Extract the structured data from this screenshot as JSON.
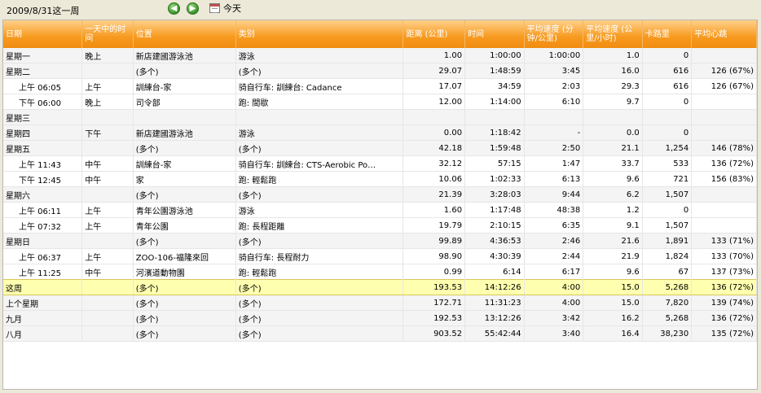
{
  "header": {
    "date_title": "2009/8/31这一周",
    "prev_symbol": "◀",
    "next_symbol": "▶",
    "today_label": "今天"
  },
  "table": {
    "columns": [
      "日期",
      "一天中的时间",
      "位置",
      "类别",
      "距离 (公里)",
      "时间",
      "平均速度 (分钟/公里)",
      "平均速度 (公里/小时)",
      "卡路里",
      "平均心跳"
    ],
    "rows": [
      {
        "kind": "group",
        "cells": [
          "星期一",
          "晚上",
          "新店建國游泳池",
          "游泳",
          "1.00",
          "1:00:00",
          "1:00:00",
          "1.0",
          "0",
          ""
        ]
      },
      {
        "kind": "group",
        "cells": [
          "星期二",
          "",
          "(多个)",
          "(多个)",
          "29.07",
          "1:48:59",
          "3:45",
          "16.0",
          "616",
          "126 (67%)"
        ]
      },
      {
        "kind": "sub",
        "cells": [
          "上午 06:05",
          "上午",
          "訓練台-家",
          "骑自行车: 訓練台: Cadance",
          "17.07",
          "34:59",
          "2:03",
          "29.3",
          "616",
          "126 (67%)"
        ]
      },
      {
        "kind": "sub",
        "cells": [
          "下午 06:00",
          "晚上",
          "司令部",
          "跑: 間歇",
          "12.00",
          "1:14:00",
          "6:10",
          "9.7",
          "0",
          ""
        ]
      },
      {
        "kind": "group",
        "cells": [
          "星期三",
          "",
          "",
          "",
          "",
          "",
          "",
          "",
          "",
          ""
        ]
      },
      {
        "kind": "group",
        "cells": [
          "星期四",
          "下午",
          "新店建國游泳池",
          "游泳",
          "0.00",
          "1:18:42",
          "-",
          "0.0",
          "0",
          ""
        ]
      },
      {
        "kind": "group",
        "cells": [
          "星期五",
          "",
          "(多个)",
          "(多个)",
          "42.18",
          "1:59:48",
          "2:50",
          "21.1",
          "1,254",
          "146 (78%)"
        ]
      },
      {
        "kind": "sub",
        "cells": [
          "上午 11:43",
          "中午",
          "訓練台-家",
          "骑自行车: 訓練台: CTS-Aerobic Po…",
          "32.12",
          "57:15",
          "1:47",
          "33.7",
          "533",
          "136 (72%)"
        ]
      },
      {
        "kind": "sub",
        "cells": [
          "下午 12:45",
          "中午",
          "家",
          "跑: 輕鬆跑",
          "10.06",
          "1:02:33",
          "6:13",
          "9.6",
          "721",
          "156 (83%)"
        ]
      },
      {
        "kind": "group",
        "cells": [
          "星期六",
          "",
          "(多个)",
          "(多个)",
          "21.39",
          "3:28:03",
          "9:44",
          "6.2",
          "1,507",
          ""
        ]
      },
      {
        "kind": "sub",
        "cells": [
          "上午 06:11",
          "上午",
          "青年公園游泳池",
          "游泳",
          "1.60",
          "1:17:48",
          "48:38",
          "1.2",
          "0",
          ""
        ]
      },
      {
        "kind": "sub",
        "cells": [
          "上午 07:32",
          "上午",
          "青年公園",
          "跑: 長程距離",
          "19.79",
          "2:10:15",
          "6:35",
          "9.1",
          "1,507",
          ""
        ]
      },
      {
        "kind": "group",
        "cells": [
          "星期日",
          "",
          "(多个)",
          "(多个)",
          "99.89",
          "4:36:53",
          "2:46",
          "21.6",
          "1,891",
          "133 (71%)"
        ]
      },
      {
        "kind": "sub",
        "cells": [
          "上午 06:37",
          "上午",
          "ZOO-106-福隆來回",
          "骑自行车: 長程耐力",
          "98.90",
          "4:30:39",
          "2:44",
          "21.9",
          "1,824",
          "133 (70%)"
        ]
      },
      {
        "kind": "sub",
        "cells": [
          "上午 11:25",
          "中午",
          "河濱道動物園",
          "跑: 輕鬆跑",
          "0.99",
          "6:14",
          "6:17",
          "9.6",
          "67",
          "137 (73%)"
        ]
      },
      {
        "kind": "current",
        "cells": [
          "这周",
          "",
          "(多个)",
          "(多个)",
          "193.53",
          "14:12:26",
          "4:00",
          "15.0",
          "5,268",
          "136 (72%)"
        ]
      },
      {
        "kind": "summary",
        "cells": [
          "上个星期",
          "",
          "(多个)",
          "(多个)",
          "172.71",
          "11:31:23",
          "4:00",
          "15.0",
          "7,820",
          "139 (74%)"
        ]
      },
      {
        "kind": "summary",
        "cells": [
          "九月",
          "",
          "(多个)",
          "(多个)",
          "192.53",
          "13:12:26",
          "3:42",
          "16.2",
          "5,268",
          "136 (72%)"
        ]
      },
      {
        "kind": "summary",
        "cells": [
          "八月",
          "",
          "(多个)",
          "(多个)",
          "903.52",
          "55:42:44",
          "3:40",
          "16.4",
          "38,230",
          "135 (72%)"
        ]
      }
    ]
  }
}
